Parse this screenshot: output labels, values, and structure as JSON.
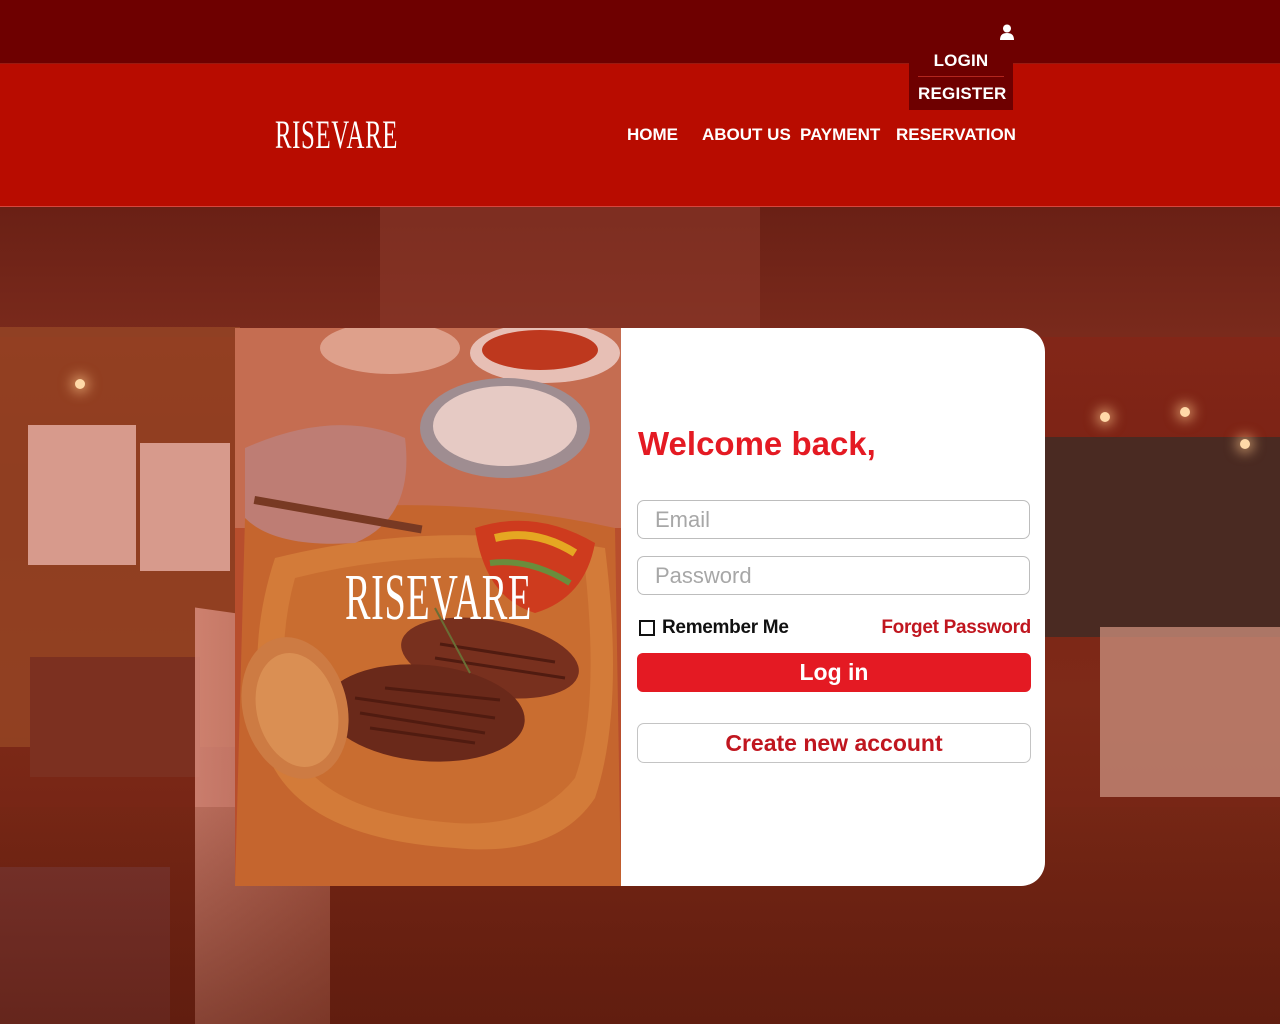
{
  "brand": {
    "name": "RISEVARE"
  },
  "auth_menu": {
    "login": "LOGIN",
    "register": "REGISTER",
    "icon": "user-icon"
  },
  "nav": {
    "items": [
      "HOME",
      "ABOUT US",
      "PAYMENT",
      "RESERVATION"
    ]
  },
  "login_card": {
    "welcome": "Welcome back,",
    "email_placeholder": "Email",
    "email_value": "",
    "password_placeholder": "Password",
    "password_value": "",
    "remember_label": "Remember Me",
    "remember_checked": false,
    "forgot_label": "Forget Password",
    "login_button": "Log in",
    "create_button": "Create new account"
  },
  "colors": {
    "topbar": "#6e0000",
    "header": "#b80c00",
    "accent": "#e41a23",
    "link": "#c0161f"
  }
}
